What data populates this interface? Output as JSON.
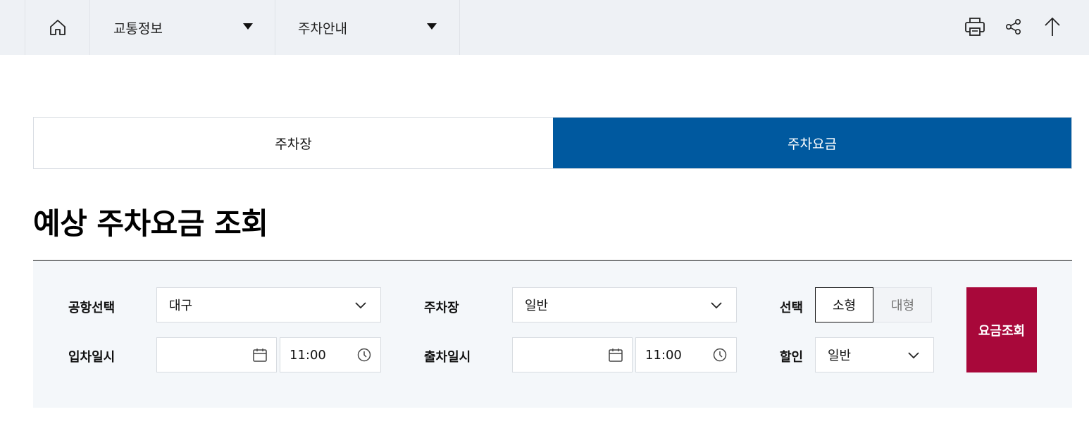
{
  "topbar": {
    "home_icon": "home-icon",
    "menu1": "교통정보",
    "menu2": "주차안내",
    "tools": [
      "print-icon",
      "share-icon",
      "arrow-up-icon"
    ]
  },
  "tabs": [
    {
      "label": "주차장",
      "active": false
    },
    {
      "label": "주차요금",
      "active": true
    }
  ],
  "page_title": "예상 주차요금 조회",
  "form": {
    "airport_label": "공항선택",
    "airport_value": "대구",
    "parking_label": "주차장",
    "parking_value": "일반",
    "select_label": "선택",
    "vehicle_small": "소형",
    "vehicle_large": "대형",
    "entry_label": "입차일시",
    "entry_date": "",
    "entry_time": "11:00",
    "exit_label": "출차일시",
    "exit_date": "",
    "exit_time": "11:00",
    "discount_label": "할인",
    "discount_value": "일반",
    "search_button": "요금조회"
  },
  "colors": {
    "active_tab": "#00599f",
    "search_button": "#a8083a",
    "topbar_bg": "#eef1f5",
    "panel_bg": "#f4f7fa"
  }
}
